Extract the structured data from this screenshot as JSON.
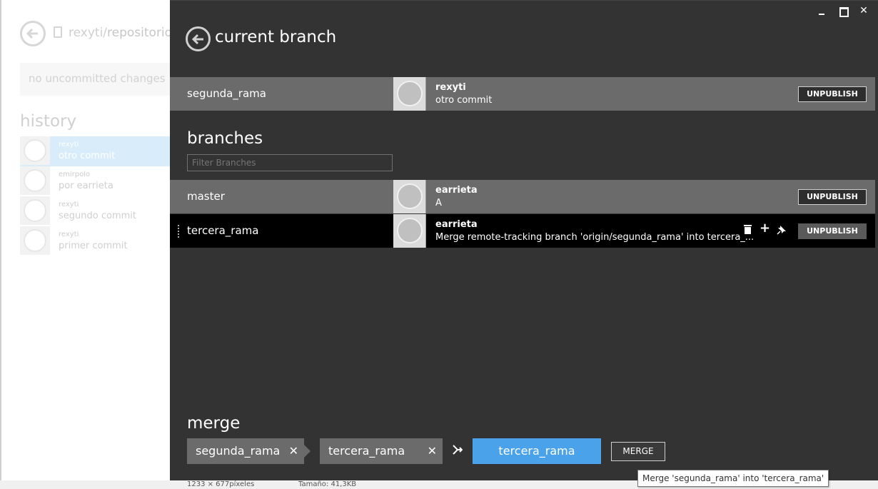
{
  "left_panel": {
    "repo_owner": "rexyti",
    "repo_name": "repositorioN",
    "changes_text": "no uncommitted changes",
    "history_title": "history",
    "history": [
      {
        "author": "rexyti",
        "message": "otro commit",
        "selected": true
      },
      {
        "author": "emirpolo",
        "message": "por earrieta",
        "selected": false
      },
      {
        "author": "rexyti",
        "message": "segundo commit",
        "selected": false
      },
      {
        "author": "rexyti",
        "message": "primer commit",
        "selected": false
      }
    ]
  },
  "window": {
    "minimize_icon": "minimize-icon",
    "maximize_icon": "maximize-icon",
    "close_icon": "close-icon",
    "close_glyph": "✕"
  },
  "current_branch": {
    "title": "current branch",
    "name": "segunda_rama",
    "author": "rexyti",
    "message": "otro commit",
    "action": "UNPUBLISH"
  },
  "branches": {
    "title": "branches",
    "filter_placeholder": "Filter Branches",
    "items": [
      {
        "name": "master",
        "author": "earrieta",
        "message": "A",
        "action": "UNPUBLISH",
        "highlighted": false
      },
      {
        "name": "tercera_rama",
        "author": "earrieta",
        "message": "Merge remote-tracking branch 'origin/segunda_rama' into tercera_...",
        "action": "UNPUBLISH",
        "highlighted": true
      }
    ],
    "row_icons": [
      "trash-icon",
      "plus-icon",
      "pin-icon"
    ]
  },
  "merge": {
    "title": "merge",
    "source": "segunda_rama",
    "destination": "tercera_rama",
    "remove_glyph": "✕",
    "result": "tercera_rama",
    "button": "MERGE",
    "tooltip": "Merge 'segunda_rama' into 'tercera_rama'"
  },
  "status_bar": {
    "dimensions": "1233 × 677píxeles",
    "size": "Tamaño: 41,3KB"
  },
  "colors": {
    "main_bg": "#333333",
    "row_gray": "#6b6b6b",
    "row_selected": "#000000",
    "accent": "#4aa3ea"
  }
}
